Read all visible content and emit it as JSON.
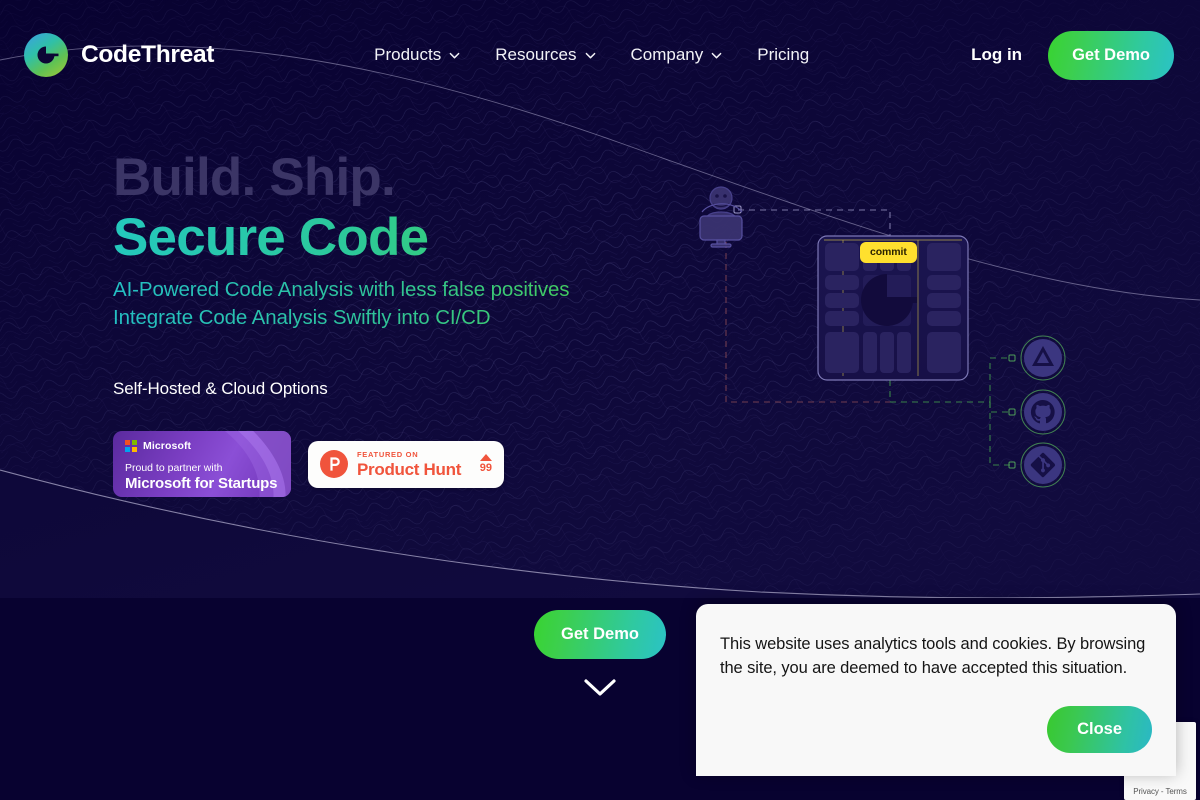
{
  "brand": {
    "name": "CodeThreat",
    "logo_icon": "codethreat-circle-logo"
  },
  "nav": {
    "items": [
      {
        "label": "Products",
        "has_dropdown": true,
        "icon": "chevron-down-icon"
      },
      {
        "label": "Resources",
        "has_dropdown": true,
        "icon": "chevron-down-icon"
      },
      {
        "label": "Company",
        "has_dropdown": true,
        "icon": "chevron-down-icon"
      },
      {
        "label": "Pricing",
        "has_dropdown": false,
        "icon": ""
      }
    ],
    "login_label": "Log in",
    "demo_label": "Get Demo"
  },
  "hero": {
    "headline_muted": "Build. Ship.",
    "headline_accent": "Secure Code",
    "subtitle_line1": "AI-Powered Code Analysis with less false positives",
    "subtitle_line2": "Integrate Code Analysis Swiftly into CI/CD",
    "options_label": "Self-Hosted & Cloud Options"
  },
  "badges": {
    "microsoft": {
      "logo_icon": "microsoft-squares-icon",
      "wordmark": "Microsoft",
      "line1": "Proud to partner with",
      "line2": "Microsoft for Startups"
    },
    "product_hunt": {
      "logo_icon": "product-hunt-icon",
      "featured_label": "FEATURED ON",
      "name": "Product Hunt",
      "upvote_icon": "upvote-triangle-icon",
      "upvote_count": "99"
    }
  },
  "illustration": {
    "developer_icon": "developer-at-computer-icon",
    "commit_label": "commit",
    "panel_icon": "codethreat-c-icon",
    "integrations": [
      {
        "name": "azure-devops-icon"
      },
      {
        "name": "github-icon"
      },
      {
        "name": "git-icon"
      }
    ]
  },
  "cta": {
    "demo_label": "Get Demo",
    "scroll_icon": "chevron-down-icon"
  },
  "cookie": {
    "message": "This website uses analytics tools and cookies. By browsing the site, you are deemed to have accepted this situation.",
    "close_label": "Close"
  },
  "recaptcha": {
    "icon": "recaptcha-shield-icon",
    "privacy_terms": "Privacy - Terms"
  },
  "colors": {
    "background": "#080230",
    "accent_green": "#38d430",
    "accent_teal": "#2bc2c6",
    "headline_muted": "#3b3566",
    "commit_yellow": "#ffe02e",
    "product_hunt_red": "#f0543c",
    "microsoft_purple": "#7c3fc4"
  }
}
